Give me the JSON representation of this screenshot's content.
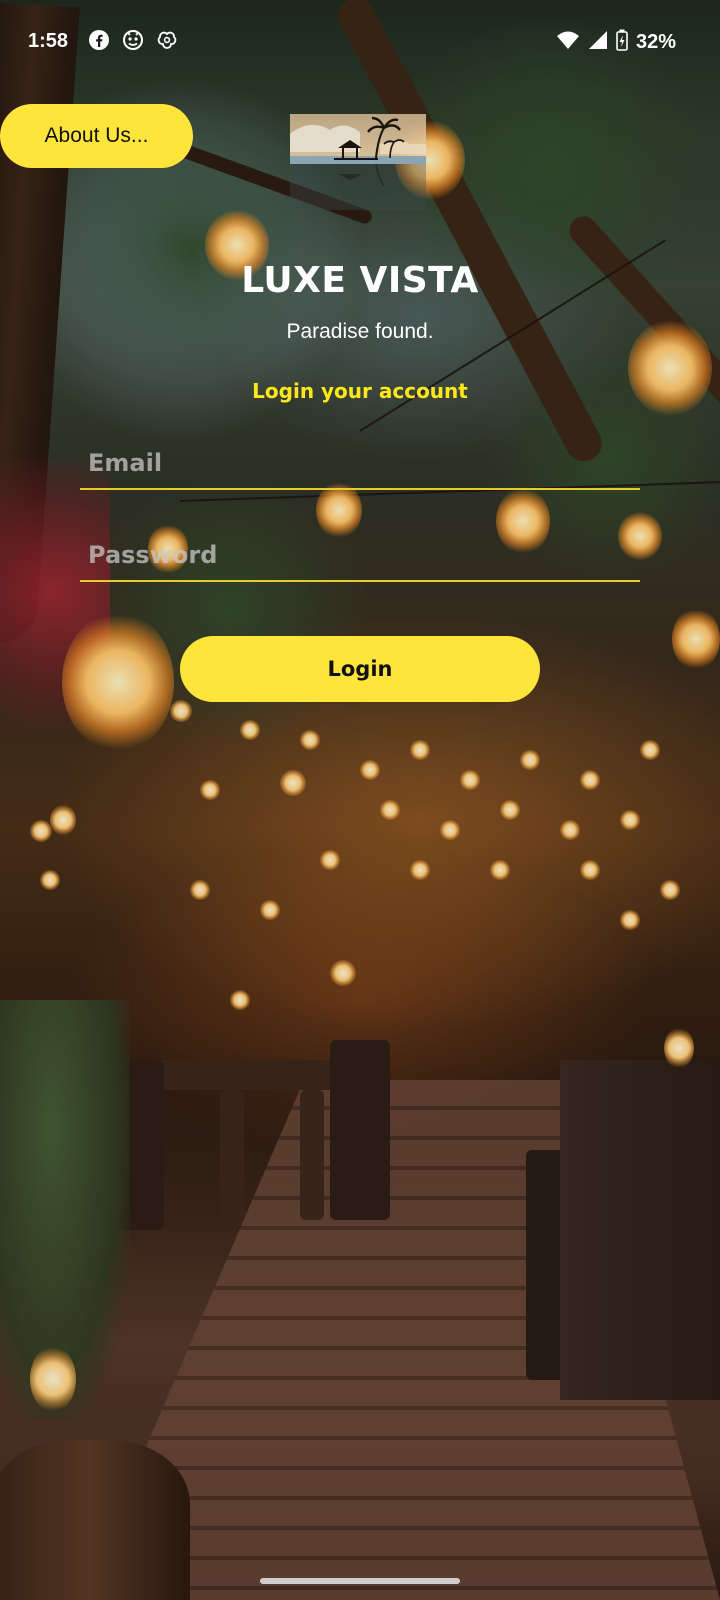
{
  "status_bar": {
    "time": "1:58",
    "left_icons": [
      "facebook-icon",
      "bug-icon",
      "app-icon"
    ],
    "right_icons": [
      "wifi-icon",
      "signal-icon",
      "battery-charging-icon"
    ],
    "battery": "32%"
  },
  "about_button": {
    "label": "About Us..."
  },
  "header": {
    "title": "LUXE VISTA",
    "tagline": "Paradise found.",
    "login_heading": "Login your account"
  },
  "form": {
    "email_placeholder": "Email",
    "email_value": "",
    "password_placeholder": "Password",
    "password_value": "",
    "login_label": "Login"
  },
  "colors": {
    "accent": "#ffe53b",
    "heading": "#ffe81a",
    "underline": "#e6cc2a",
    "text": "#ffffff"
  }
}
